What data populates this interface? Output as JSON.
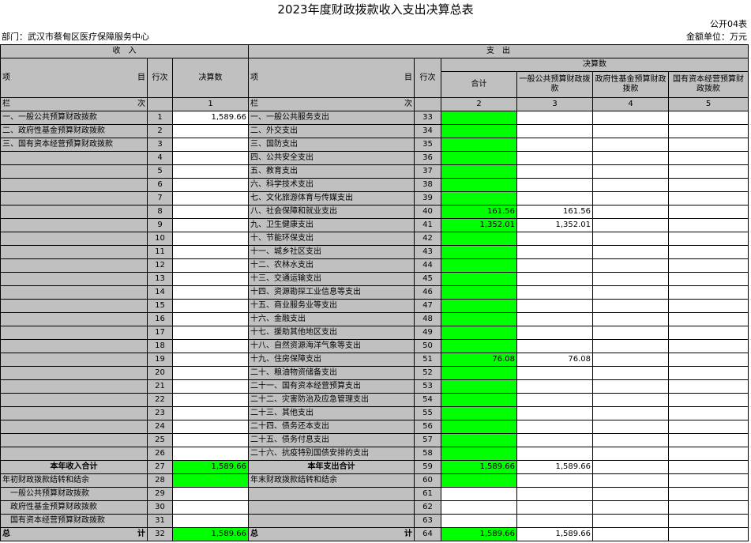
{
  "title": "2023年度财政拨款收入支出决算总表",
  "form_code": "公开04表",
  "department": "部门：武汉市蔡甸区医疗保障服务中心",
  "unit": "金额单位：万元",
  "headers": {
    "income": "收　入",
    "expense": "支　出",
    "item_left": "项",
    "item_right": "目",
    "row_no": "行次",
    "final_amount": "决算数",
    "total": "合计",
    "general_budget": "一般公共预算财政拨款",
    "gov_fund": "政府性基金预算财政拨款",
    "state_capital": "国有资本经营预算财政拨款",
    "lan": "栏",
    "ci": "次",
    "col1": "1",
    "col2": "2",
    "col3": "3",
    "col4": "4",
    "col5": "5"
  },
  "rows": [
    {
      "inc_name": "一、一般公共预算财政拨款",
      "inc_no": "1",
      "inc_val": "1,589.66",
      "exp_name": "一、一般公共服务支出",
      "exp_no": "33",
      "total": "",
      "gen": "",
      "fund": "",
      "cap": ""
    },
    {
      "inc_name": "二、政府性基金预算财政拨款",
      "inc_no": "2",
      "inc_val": "",
      "exp_name": "二、外交支出",
      "exp_no": "34",
      "total": "",
      "gen": "",
      "fund": "",
      "cap": ""
    },
    {
      "inc_name": "三、国有资本经营预算财政拨款",
      "inc_no": "3",
      "inc_val": "",
      "exp_name": "三、国防支出",
      "exp_no": "35",
      "total": "",
      "gen": "",
      "fund": "",
      "cap": ""
    },
    {
      "inc_name": "",
      "inc_no": "4",
      "inc_val": "",
      "exp_name": "四、公共安全支出",
      "exp_no": "36",
      "total": "",
      "gen": "",
      "fund": "",
      "cap": ""
    },
    {
      "inc_name": "",
      "inc_no": "5",
      "inc_val": "",
      "exp_name": "五、教育支出",
      "exp_no": "37",
      "total": "",
      "gen": "",
      "fund": "",
      "cap": ""
    },
    {
      "inc_name": "",
      "inc_no": "6",
      "inc_val": "",
      "exp_name": "六、科学技术支出",
      "exp_no": "38",
      "total": "",
      "gen": "",
      "fund": "",
      "cap": ""
    },
    {
      "inc_name": "",
      "inc_no": "7",
      "inc_val": "",
      "exp_name": "七、文化旅游体育与传媒支出",
      "exp_no": "39",
      "total": "",
      "gen": "",
      "fund": "",
      "cap": ""
    },
    {
      "inc_name": "",
      "inc_no": "8",
      "inc_val": "",
      "exp_name": "八、社会保障和就业支出",
      "exp_no": "40",
      "total": "161.56",
      "gen": "161.56",
      "fund": "",
      "cap": ""
    },
    {
      "inc_name": "",
      "inc_no": "9",
      "inc_val": "",
      "exp_name": "九、卫生健康支出",
      "exp_no": "41",
      "total": "1,352.01",
      "gen": "1,352.01",
      "fund": "",
      "cap": ""
    },
    {
      "inc_name": "",
      "inc_no": "10",
      "inc_val": "",
      "exp_name": "十、节能环保支出",
      "exp_no": "42",
      "total": "",
      "gen": "",
      "fund": "",
      "cap": ""
    },
    {
      "inc_name": "",
      "inc_no": "11",
      "inc_val": "",
      "exp_name": "十一、城乡社区支出",
      "exp_no": "43",
      "total": "",
      "gen": "",
      "fund": "",
      "cap": ""
    },
    {
      "inc_name": "",
      "inc_no": "12",
      "inc_val": "",
      "exp_name": "十二、农林水支出",
      "exp_no": "44",
      "total": "",
      "gen": "",
      "fund": "",
      "cap": ""
    },
    {
      "inc_name": "",
      "inc_no": "13",
      "inc_val": "",
      "exp_name": "十三、交通运输支出",
      "exp_no": "45",
      "total": "",
      "gen": "",
      "fund": "",
      "cap": ""
    },
    {
      "inc_name": "",
      "inc_no": "14",
      "inc_val": "",
      "exp_name": "十四、资源勘探工业信息等支出",
      "exp_no": "46",
      "total": "",
      "gen": "",
      "fund": "",
      "cap": ""
    },
    {
      "inc_name": "",
      "inc_no": "15",
      "inc_val": "",
      "exp_name": "十五、商业服务业等支出",
      "exp_no": "47",
      "total": "",
      "gen": "",
      "fund": "",
      "cap": ""
    },
    {
      "inc_name": "",
      "inc_no": "16",
      "inc_val": "",
      "exp_name": "十六、金融支出",
      "exp_no": "48",
      "total": "",
      "gen": "",
      "fund": "",
      "cap": ""
    },
    {
      "inc_name": "",
      "inc_no": "17",
      "inc_val": "",
      "exp_name": "十七、援助其他地区支出",
      "exp_no": "49",
      "total": "",
      "gen": "",
      "fund": "",
      "cap": ""
    },
    {
      "inc_name": "",
      "inc_no": "18",
      "inc_val": "",
      "exp_name": "十八、自然资源海洋气象等支出",
      "exp_no": "50",
      "total": "",
      "gen": "",
      "fund": "",
      "cap": ""
    },
    {
      "inc_name": "",
      "inc_no": "19",
      "inc_val": "",
      "exp_name": "十九、住房保障支出",
      "exp_no": "51",
      "total": "76.08",
      "gen": "76.08",
      "fund": "",
      "cap": ""
    },
    {
      "inc_name": "",
      "inc_no": "20",
      "inc_val": "",
      "exp_name": "二十、粮油物资储备支出",
      "exp_no": "52",
      "total": "",
      "gen": "",
      "fund": "",
      "cap": ""
    },
    {
      "inc_name": "",
      "inc_no": "21",
      "inc_val": "",
      "exp_name": "二十一、国有资本经营预算支出",
      "exp_no": "53",
      "total": "",
      "gen": "",
      "fund": "",
      "cap": ""
    },
    {
      "inc_name": "",
      "inc_no": "22",
      "inc_val": "",
      "exp_name": "二十二、灾害防治及应急管理支出",
      "exp_no": "54",
      "total": "",
      "gen": "",
      "fund": "",
      "cap": ""
    },
    {
      "inc_name": "",
      "inc_no": "23",
      "inc_val": "",
      "exp_name": "二十三、其他支出",
      "exp_no": "55",
      "total": "",
      "gen": "",
      "fund": "",
      "cap": ""
    },
    {
      "inc_name": "",
      "inc_no": "24",
      "inc_val": "",
      "exp_name": "二十四、债务还本支出",
      "exp_no": "56",
      "total": "",
      "gen": "",
      "fund": "",
      "cap": ""
    },
    {
      "inc_name": "",
      "inc_no": "25",
      "inc_val": "",
      "exp_name": "二十五、债务付息支出",
      "exp_no": "57",
      "total": "",
      "gen": "",
      "fund": "",
      "cap": ""
    },
    {
      "inc_name": "",
      "inc_no": "26",
      "inc_val": "",
      "exp_name": "二十六、抗疫特别国债安排的支出",
      "exp_no": "58",
      "total": "",
      "gen": "",
      "fund": "",
      "cap": ""
    }
  ],
  "summary": {
    "inc_total_label": "本年收入合计",
    "inc_total_no": "27",
    "inc_total_val": "1,589.66",
    "exp_total_label": "本年支出合计",
    "exp_total_no": "59",
    "exp_total_val": "1,589.66",
    "exp_total_gen": "1,589.66",
    "begin_label": "年初财政拨款结转和结余",
    "begin_no": "28",
    "end_label": "年末财政拨款结转和结余",
    "end_no": "60",
    "sub1_label": "一般公共预算财政拨款",
    "sub1_no": "29",
    "sub1_exp_no": "61",
    "sub2_label": "政府性基金预算财政拨款",
    "sub2_no": "30",
    "sub2_exp_no": "62",
    "sub3_label": "国有资本经营预算财政拨款",
    "sub3_no": "31",
    "sub3_exp_no": "63",
    "grand_left": "总",
    "grand_right": "计",
    "grand_inc_no": "32",
    "grand_inc_val": "1,589.66",
    "grand_exp_no": "64",
    "grand_exp_val": "1,589.66",
    "grand_exp_gen": "1,589.66"
  }
}
